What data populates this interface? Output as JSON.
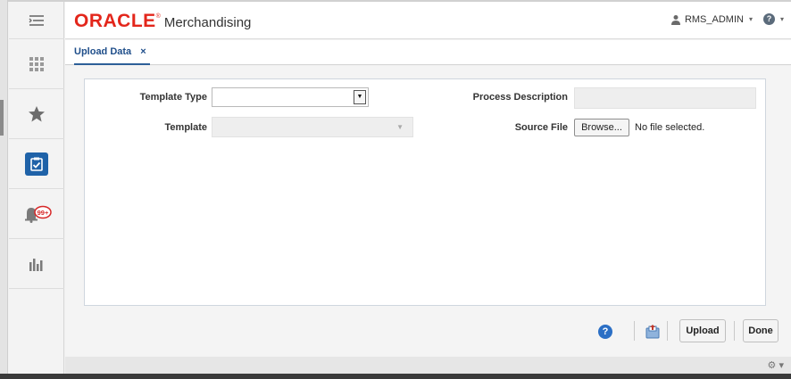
{
  "header": {
    "brand": "ORACLE",
    "brand_mark": "®",
    "product": "Merchandising",
    "user": "RMS_ADMIN",
    "help_glyph": "?",
    "caret": "▾"
  },
  "sidebar": {
    "items": [
      {
        "id": "menu",
        "icon": "hamburger-menu-icon"
      },
      {
        "id": "task-list",
        "icon": "grid-icon"
      },
      {
        "id": "favorites",
        "icon": "star-icon"
      },
      {
        "id": "tasks",
        "icon": "clipboard-check-icon",
        "active": true
      },
      {
        "id": "notifications",
        "icon": "bell-icon",
        "badge": "99+"
      },
      {
        "id": "reports",
        "icon": "bar-chart-icon"
      }
    ]
  },
  "tabs": [
    {
      "label": "Upload Data",
      "close": "×"
    }
  ],
  "form": {
    "template_type_label": "Template Type",
    "template_label": "Template",
    "process_description_label": "Process Description",
    "source_file_label": "Source File",
    "template_type_value": "",
    "template_value": "",
    "process_description_value": "",
    "browse_label": "Browse...",
    "file_status": "No file selected."
  },
  "actions": {
    "help": "?",
    "upload": "Upload",
    "done": "Done"
  },
  "colors": {
    "brand_red": "#e3261b",
    "accent_blue": "#1f62a8",
    "tab_text": "#1f4e8a",
    "badge_red": "#d62828"
  }
}
